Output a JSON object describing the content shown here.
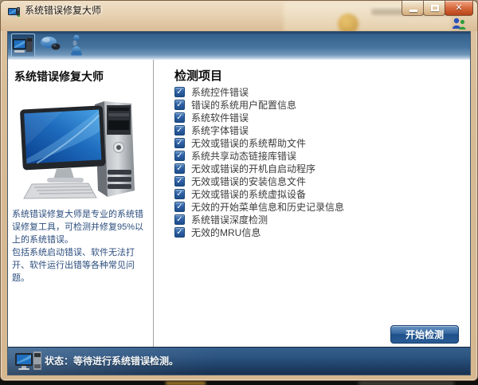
{
  "window": {
    "title": "系统错误修复大师",
    "controls": {
      "close_glyph": "✕"
    }
  },
  "toolbar": {
    "icons": [
      {
        "name": "system-repair-tool-icon",
        "selected": true
      },
      {
        "name": "mouse-tool-icon",
        "selected": false
      },
      {
        "name": "assistant-tool-icon",
        "selected": false
      }
    ]
  },
  "left_panel": {
    "title": "系统错误修复大师",
    "description_lines": [
      "系统错误修复大师是专业的系统错误修复工具，可检测并修复95%以上的系统错误。",
      "包括系统启动错误、软件无法打开、软件运行出错等各种常见问题。"
    ]
  },
  "right_panel": {
    "title": "检测项目",
    "check_glyph": "✓",
    "items": [
      {
        "label": "系统控件错误",
        "checked": true
      },
      {
        "label": "错误的系统用户配置信息",
        "checked": true
      },
      {
        "label": "系统软件错误",
        "checked": true
      },
      {
        "label": "系统字体错误",
        "checked": true
      },
      {
        "label": "无效或错误的系统帮助文件",
        "checked": true
      },
      {
        "label": "系统共享动态链接库错误",
        "checked": true
      },
      {
        "label": "无效或错误的开机自启动程序",
        "checked": true
      },
      {
        "label": "无效或错误的安装信息文件",
        "checked": true
      },
      {
        "label": "无效或错误的系统虚拟设备",
        "checked": true
      },
      {
        "label": "无效的开始菜单信息和历史记录信息",
        "checked": true
      },
      {
        "label": "系统错误深度检测",
        "checked": true
      },
      {
        "label": "无效的MRU信息",
        "checked": true
      }
    ],
    "start_button": "开始检测"
  },
  "statusbar": {
    "text": "状态：等待进行系统错误检测。"
  },
  "colors": {
    "frame_tan": "#d9bb96",
    "toolbar_blue": "#46749f",
    "status_navy": "#1d3f66",
    "checkbox_blue": "#2f62a5",
    "button_blue": "#2c5e97",
    "close_red": "#c9502f",
    "description_text": "#2c4e7e"
  }
}
